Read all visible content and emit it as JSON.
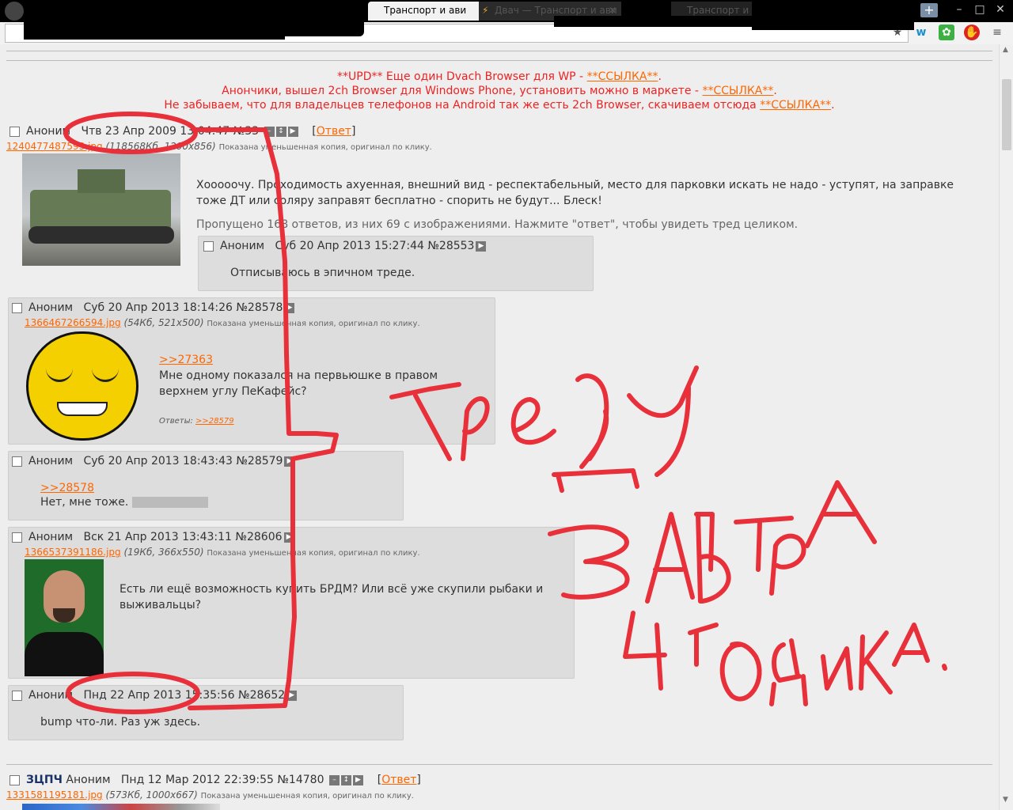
{
  "browser": {
    "tabs": [
      {
        "label": "Транспорт и ави",
        "active": true
      },
      {
        "label": "Двач — Транспорт и ави",
        "active": false
      },
      {
        "label": "Транспорт и",
        "active": false
      }
    ],
    "new_tab": "+",
    "window_buttons": [
      "–",
      "□",
      "✕"
    ],
    "extensions": [
      "star-icon",
      "wave-icon",
      "share-icon",
      "adblock-icon",
      "menu-icon"
    ]
  },
  "announcement": {
    "line1_text": "**UPD** Еще один Dvach Browser для WP - ",
    "line1_link": "**ССЫЛКА**",
    "line1_end": ".",
    "line2_text": "Анончики, вышел 2ch Browser для Windows Phone, установить можно в маркете - ",
    "line2_link": " **ССЫЛКА**",
    "line2_end": ".",
    "line3_text": "Не забываем, что для владельцев телефонов на Android так же есть 2ch Browser, скачиваем отсюда ",
    "line3_link": "**ССЫЛКА**",
    "line3_end": "."
  },
  "op": {
    "name": "Аноним",
    "date": "Чтв 23 Апр 2009 13:04:47",
    "num": "№33",
    "reply": "Ответ",
    "file": "1240477487593.jpg",
    "file_meta": "(118568Кб, 1200x856)",
    "file_note": "Показана уменьшенная копия, оригинал по клику.",
    "text": "Хооооочу. Проходимость ахуенная, внешний вид - респектабельный, место для парковки искать не надо - уступят, на заправке тоже ДТ или соляру заправят бесплатно - спорить не будут... Блеск!",
    "omitted": "Пропущено 168 ответов, из них 69 с изображениями. Нажмите \"ответ\", чтобы увидеть тред целиком."
  },
  "replies": [
    {
      "name": "Аноним",
      "date": "Суб 20 Апр 2013 15:27:44",
      "num": "№28553",
      "text": "Отписываюсь в эпичном треде."
    },
    {
      "name": "Аноним",
      "date": "Суб 20 Апр 2013 18:14:26",
      "num": "№28578",
      "file": "1366467266594.jpg",
      "file_meta": "(54Кб, 521x500)",
      "file_note": "Показана уменьшенная копия, оригинал по клику.",
      "quote": ">>27363",
      "text": "Мне одному показался на первьюшке в правом верхнем углу ПеКафейс?",
      "answers_label": "Ответы:",
      "answers_link": ">>28579"
    },
    {
      "name": "Аноним",
      "date": "Суб 20 Апр 2013 18:43:43",
      "num": "№28579",
      "quote": ">>28578",
      "text": "Нет, мне тоже."
    },
    {
      "name": "Аноним",
      "date": "Вск 21 Апр 2013 13:43:11",
      "num": "№28606",
      "file": "1366537391186.jpg",
      "file_meta": "(19Кб, 366x550)",
      "file_note": "Показана уменьшенная копия, оригинал по клику.",
      "text": "Есть ли ещё возможность купить БРДМ? Или всё уже скупили рыбаки и выживальцы?"
    },
    {
      "name": "Аноним",
      "date": "Пнд 22 Апр 2013 15:35:56",
      "num": "№28652",
      "text": "bump что-ли. Раз уж здесь."
    }
  ],
  "next_op": {
    "subject": "ЗЦПЧ",
    "name": "Аноним",
    "date": "Пнд 12 Мар 2012 22:39:55",
    "num": "№14780",
    "reply": "Ответ",
    "file": "1331581195181.jpg",
    "file_meta": "(573Кб, 1000x667)",
    "file_note": "Показана уменьшенная копия, оригинал по клику."
  },
  "handwriting": {
    "words": [
      "тред",
      "у",
      "завтра",
      "4",
      "годика",
      "."
    ],
    "color": "#e8303a"
  },
  "colors": {
    "accent": "#ff6600",
    "announce": "#ee2222",
    "post_bg": "#dddddd",
    "page_bg": "#eeeeee"
  }
}
